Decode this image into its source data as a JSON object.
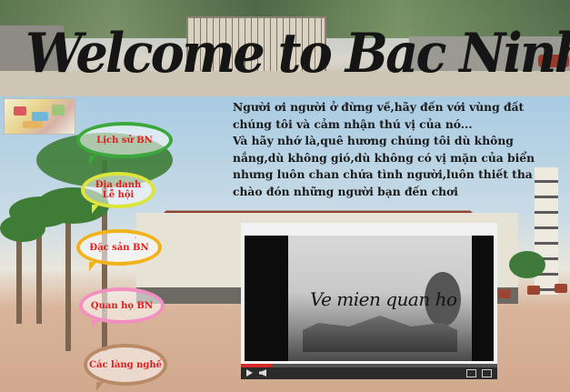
{
  "header": {
    "title": "Welcome to Bac Ninh"
  },
  "intro": {
    "lines": [
      "Người ơi người ở đừng về,hãy đến với vùng đất",
      "chúng tôi và cảm nhận thú vị của nó...",
      "Và hãy nhớ là,quê hương chúng tôi dù không",
      "nắng,dù không gió,dù không có vị mặn của biển",
      "nhưng luôn chan chứa tình người,luôn thiết tha",
      "chào đón những người bạn đến chơi"
    ]
  },
  "nav": {
    "items": [
      {
        "label": "Lịch sử BN",
        "color": "#3aa83a"
      },
      {
        "label": "Địa danh Lễ hội",
        "color": "#dde43a"
      },
      {
        "label": "Đặc sản BN",
        "color": "#f2b21b"
      },
      {
        "label": "Quan họ BN",
        "color": "#f28ec0"
      },
      {
        "label": "Các làng nghề",
        "color": "#b98a66"
      }
    ]
  },
  "video": {
    "caption": "Ve mien quan ho",
    "progress": 0.12,
    "progress_color": "#d62a2a"
  },
  "icons": {
    "map": "map-thumbnail-icon",
    "play": "play-icon",
    "volume": "volume-icon",
    "fullscreen": "fullscreen-icon"
  }
}
